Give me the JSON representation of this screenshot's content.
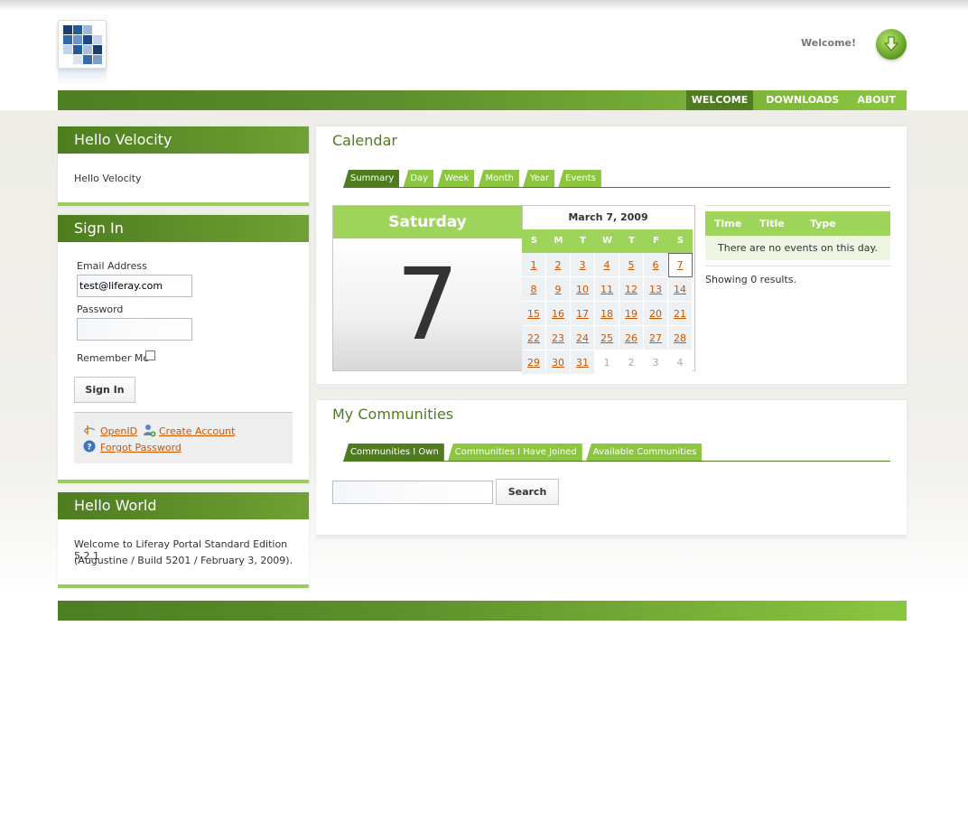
{
  "header": {
    "welcome_text": "Welcome!",
    "logo_icon": "liferay-logo-icon",
    "welcome_icon": "download-arrow-icon"
  },
  "nav": {
    "items": [
      {
        "label": "WELCOME",
        "selected": true
      },
      {
        "label": "DOWNLOADS",
        "selected": false
      },
      {
        "label": "ABOUT",
        "selected": false
      }
    ]
  },
  "hello_velocity": {
    "title": "Hello Velocity",
    "body": "Hello Velocity"
  },
  "sign_in": {
    "title": "Sign In",
    "email_label": "Email Address",
    "email_value": "test@liferay.com",
    "password_label": "Password",
    "remember_label": "Remember Me",
    "button_label": "Sign In",
    "openid_label": "OpenID",
    "create_account_label": "Create Account",
    "forgot_password_label": "Forgot Password"
  },
  "hello_world": {
    "title": "Hello World",
    "line1": "Welcome to Liferay Portal Standard Edition 5.2.1",
    "line2": "(Augustine / Build 5201 / February 3, 2009)."
  },
  "calendar": {
    "title": "Calendar",
    "tabs": [
      "Summary",
      "Day",
      "Week",
      "Month",
      "Year",
      "Events"
    ],
    "selected_tab": "Summary",
    "day_name": "Saturday",
    "day_number": "7",
    "month_title": "March 7, 2009",
    "weekdays": [
      "S",
      "M",
      "T",
      "W",
      "T",
      "F",
      "S"
    ],
    "events_columns": [
      "Time",
      "Title",
      "Type"
    ],
    "no_events": "There are no events on this day.",
    "results": "Showing 0 results."
  },
  "communities": {
    "title": "My Communities",
    "tabs": [
      "Communities I Own",
      "Communities I Have Joined",
      "Available Communities"
    ],
    "search_button": "Search"
  },
  "colors": {
    "accent_dark": "#4f7c1f",
    "accent_light": "#9fd45a",
    "link": "#cc5500"
  }
}
